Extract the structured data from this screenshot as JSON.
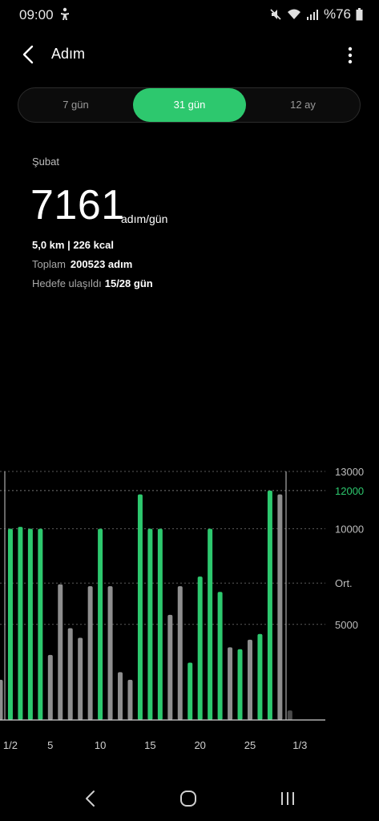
{
  "status_bar": {
    "time": "09:00",
    "battery": "%76",
    "icons": [
      "accessibility-icon",
      "mute-icon",
      "wifi-icon",
      "signal-icon",
      "battery-icon"
    ]
  },
  "app_bar": {
    "title": "Adım",
    "icons": [
      "back-arrow-icon",
      "more-vert-icon"
    ]
  },
  "tabs": [
    {
      "label": "7 gün",
      "selected": false
    },
    {
      "label": "31 gün",
      "selected": true
    },
    {
      "label": "12 ay",
      "selected": false
    }
  ],
  "summary": {
    "period": "Şubat",
    "avg_steps": "7161",
    "avg_unit": "adım/gün",
    "distance_kcal": "5,0 km  |  226 kcal",
    "total_label": "Toplam",
    "total_value": "200523 adım",
    "goal_label": "Hedefe ulaşıldı",
    "goal_value": "15/28 gün"
  },
  "colors": {
    "accent": "#2dc86e",
    "bar_miss": "#8e8e8e",
    "bar_partial": "#4a4a4a",
    "grid": "#5a5a5a"
  },
  "chart_data": {
    "type": "bar",
    "goal": 12000,
    "average": 7161,
    "ylim": [
      0,
      13000
    ],
    "y_ticks": [
      {
        "value": 13000,
        "label": "13000",
        "highlight": false
      },
      {
        "value": 12000,
        "label": "12000",
        "highlight": true
      },
      {
        "value": 10000,
        "label": "10000",
        "highlight": false
      },
      {
        "value": 7161,
        "label": "Ort.",
        "highlight": false
      },
      {
        "value": 5000,
        "label": "5000",
        "highlight": false
      }
    ],
    "x_labels": [
      {
        "index": 1,
        "label": "1/2"
      },
      {
        "index": 5,
        "label": "5"
      },
      {
        "index": 10,
        "label": "10"
      },
      {
        "index": 15,
        "label": "15"
      },
      {
        "index": 20,
        "label": "20"
      },
      {
        "index": 25,
        "label": "25"
      },
      {
        "index": 30,
        "label": "1/3"
      }
    ],
    "bars": [
      {
        "day": 0,
        "value": 2100,
        "status": "miss"
      },
      {
        "day": 1,
        "value": 10000,
        "status": "goal"
      },
      {
        "day": 2,
        "value": 10100,
        "status": "goal"
      },
      {
        "day": 3,
        "value": 10000,
        "status": "goal"
      },
      {
        "day": 4,
        "value": 10000,
        "status": "goal"
      },
      {
        "day": 5,
        "value": 3400,
        "status": "miss"
      },
      {
        "day": 6,
        "value": 7100,
        "status": "miss"
      },
      {
        "day": 7,
        "value": 4800,
        "status": "miss"
      },
      {
        "day": 8,
        "value": 4300,
        "status": "miss"
      },
      {
        "day": 9,
        "value": 7000,
        "status": "miss"
      },
      {
        "day": 10,
        "value": 10000,
        "status": "goal"
      },
      {
        "day": 11,
        "value": 7000,
        "status": "miss"
      },
      {
        "day": 12,
        "value": 2500,
        "status": "miss"
      },
      {
        "day": 13,
        "value": 2100,
        "status": "miss"
      },
      {
        "day": 14,
        "value": 11800,
        "status": "goal"
      },
      {
        "day": 15,
        "value": 10000,
        "status": "goal"
      },
      {
        "day": 16,
        "value": 10000,
        "status": "goal"
      },
      {
        "day": 17,
        "value": 5500,
        "status": "miss"
      },
      {
        "day": 18,
        "value": 7000,
        "status": "miss"
      },
      {
        "day": 19,
        "value": 3000,
        "status": "goal"
      },
      {
        "day": 20,
        "value": 7500,
        "status": "goal"
      },
      {
        "day": 21,
        "value": 10000,
        "status": "goal"
      },
      {
        "day": 22,
        "value": 6700,
        "status": "goal"
      },
      {
        "day": 23,
        "value": 3800,
        "status": "miss"
      },
      {
        "day": 24,
        "value": 3700,
        "status": "goal"
      },
      {
        "day": 25,
        "value": 4200,
        "status": "miss"
      },
      {
        "day": 26,
        "value": 4500,
        "status": "goal"
      },
      {
        "day": 27,
        "value": 12000,
        "status": "goal"
      },
      {
        "day": 28,
        "value": 11800,
        "status": "miss"
      },
      {
        "day": 29,
        "value": 500,
        "status": "partial"
      }
    ]
  },
  "nav_bar": {
    "icons": [
      "nav-back-icon",
      "nav-home-icon",
      "nav-recents-icon"
    ]
  }
}
